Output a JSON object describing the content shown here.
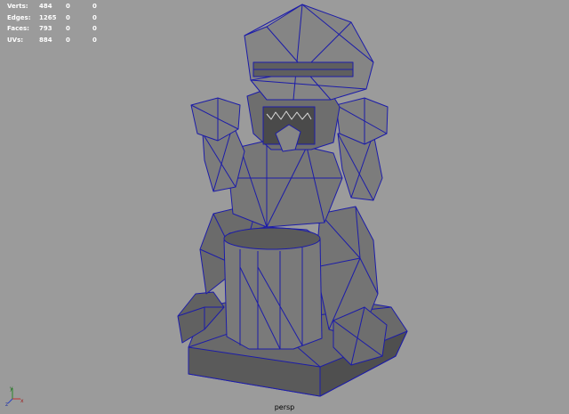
{
  "hud": {
    "rows": [
      {
        "label": "Verts:",
        "v1": "484",
        "v2": "0",
        "v3": "0"
      },
      {
        "label": "Edges:",
        "v1": "1265",
        "v2": "0",
        "v3": "0"
      },
      {
        "label": "Faces:",
        "v1": "793",
        "v2": "0",
        "v3": "0"
      },
      {
        "label": "UVs:",
        "v1": "884",
        "v2": "0",
        "v3": "0"
      }
    ]
  },
  "camera": {
    "name": "persp"
  },
  "axis": {
    "x": "x",
    "y": "y",
    "z": "z"
  },
  "colors": {
    "background": "#9b9b9b",
    "mesh_fill": "#6f6f6f",
    "wire": "#1c1ca8",
    "hud_text": "#ffffff"
  }
}
